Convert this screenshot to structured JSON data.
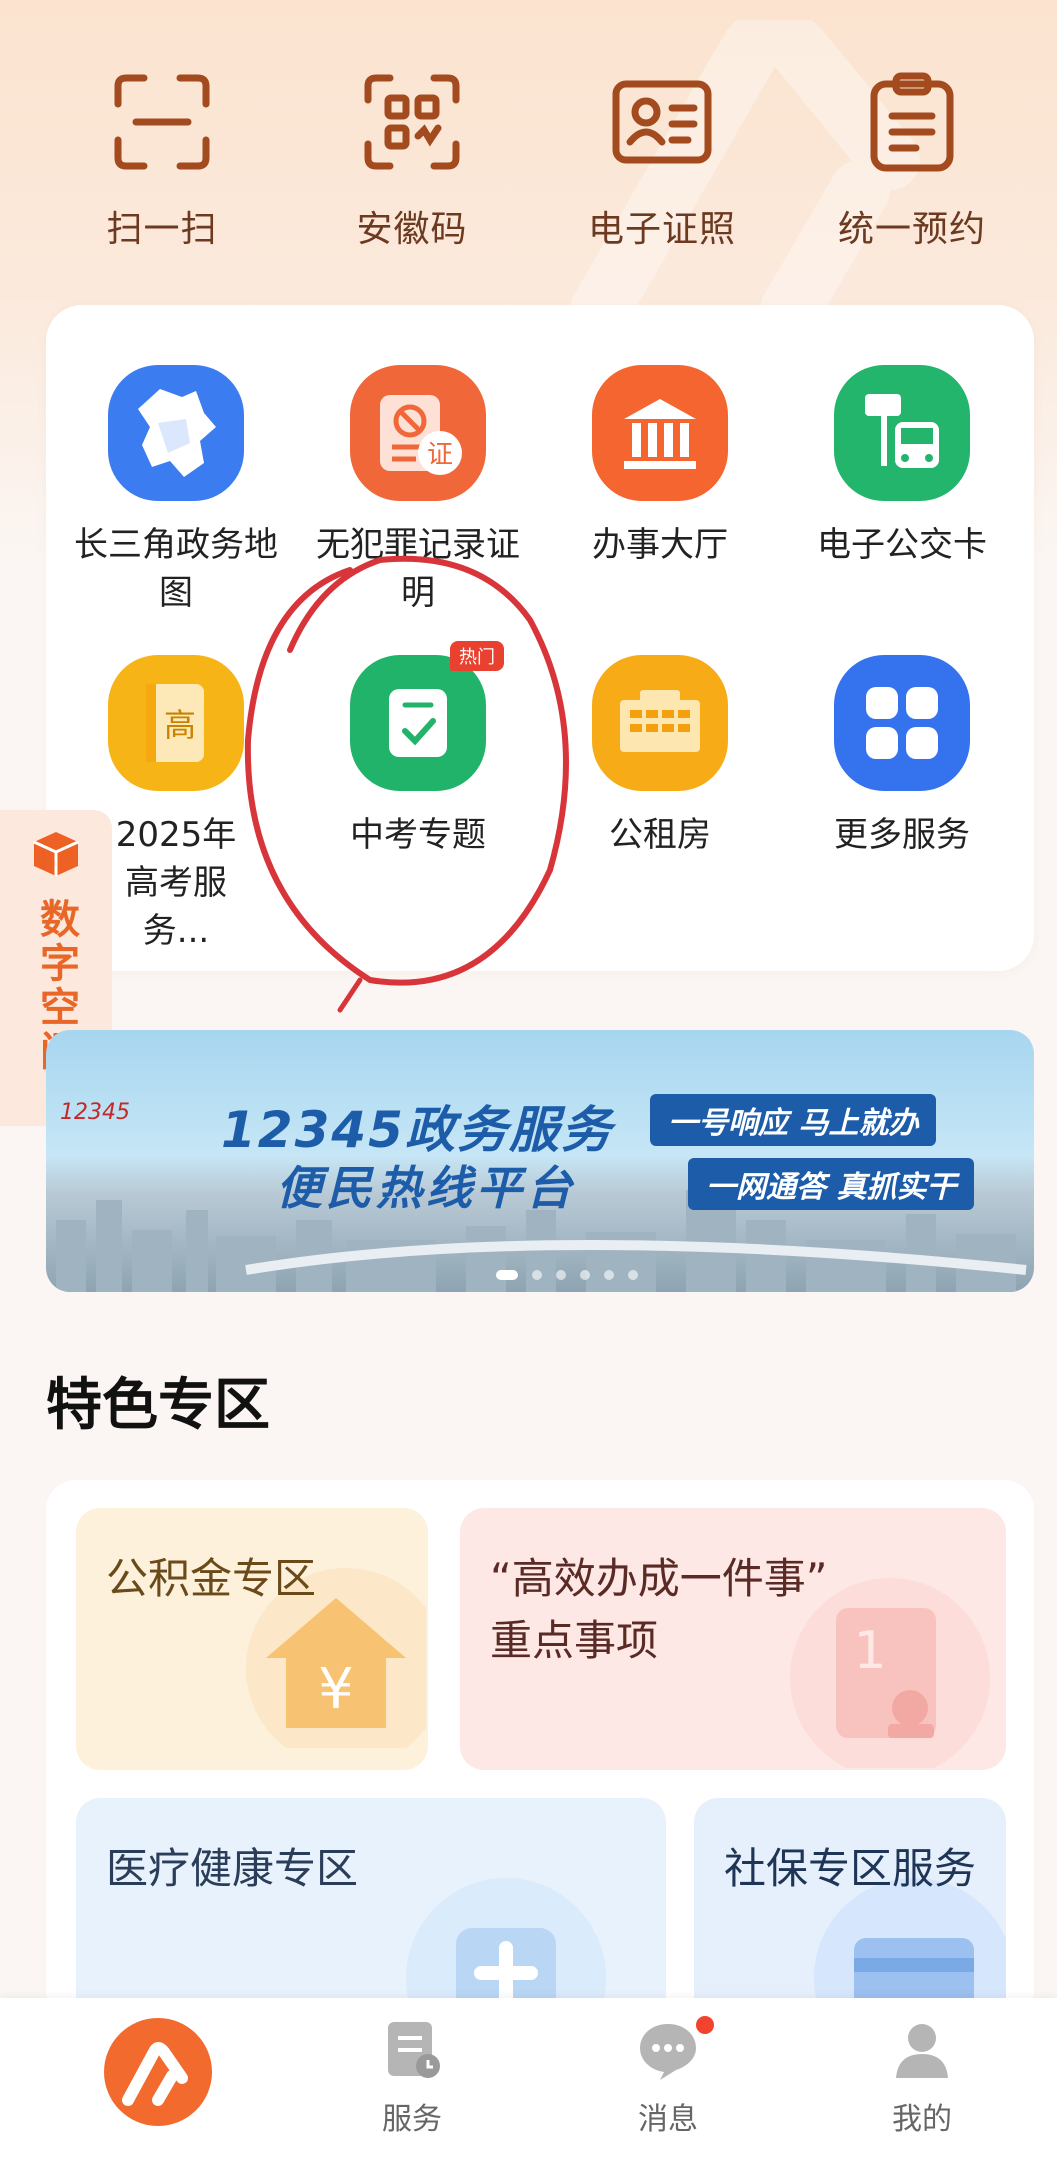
{
  "top_actions": [
    {
      "label": "扫一扫",
      "icon": "scan-icon"
    },
    {
      "label": "安徽码",
      "icon": "qr-code-icon"
    },
    {
      "label": "电子证照",
      "icon": "id-card-icon"
    },
    {
      "label": "统一预约",
      "icon": "clipboard-icon"
    }
  ],
  "services": [
    {
      "label": "长三角政务地图",
      "icon": "map-icon",
      "color": "#3b7cf0"
    },
    {
      "label": "无犯罪记录证明",
      "icon": "certificate-icon",
      "color": "#f0683a"
    },
    {
      "label": "办事大厅",
      "icon": "hall-icon",
      "color": "#f5652f"
    },
    {
      "label": "电子公交卡",
      "icon": "bus-icon",
      "color": "#23b56c"
    },
    {
      "label": "2025年高考服务...",
      "icon": "book-icon",
      "color": "#f7b417"
    },
    {
      "label": "中考专题",
      "icon": "checklist-icon",
      "color": "#22b36a",
      "badge": "热门"
    },
    {
      "label": "公租房",
      "icon": "building-icon",
      "color": "#f7ab16"
    },
    {
      "label": "更多服务",
      "icon": "grid-icon",
      "color": "#3573ee"
    }
  ],
  "side_tab": {
    "label": "数字空间",
    "icon": "cube-icon"
  },
  "banner": {
    "logo": "12345",
    "title": "12345政务服务",
    "subtitle": "便民热线平台",
    "tag1": "一号响应 马上就办",
    "tag2": "一网通答 真抓实干",
    "slides": 6,
    "active_slide": 1
  },
  "special_zone": {
    "title": "特色专区",
    "items": [
      {
        "label": "公积金专区",
        "icon": "house-yen-icon"
      },
      {
        "label": "“高效办成一件事”\n重点事项",
        "icon": "document-stamp-icon"
      },
      {
        "label": "医疗健康专区",
        "icon": "medical-kit-icon"
      },
      {
        "label": "社保专区服务",
        "icon": "social-card-icon"
      }
    ]
  },
  "bottom_nav": [
    {
      "label": "",
      "icon": "home-logo-icon"
    },
    {
      "label": "服务",
      "icon": "service-icon"
    },
    {
      "label": "消息",
      "icon": "message-icon"
    },
    {
      "label": "我的",
      "icon": "profile-icon"
    }
  ],
  "colors": {
    "brand": "#f26a2e",
    "text_brown": "#6b3a20",
    "hot": "#e9402f"
  }
}
